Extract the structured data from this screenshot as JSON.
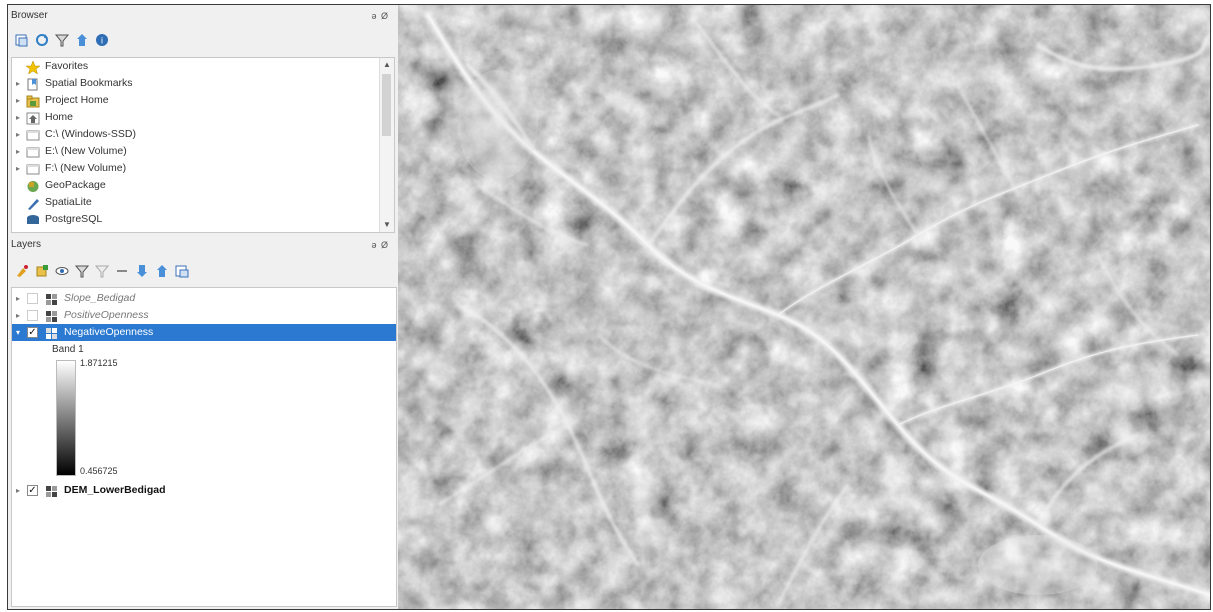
{
  "browser": {
    "title": "Browser",
    "window_controls": "ə Ø",
    "toolbar_icons": [
      "add-selected-icon",
      "refresh-icon",
      "filter-icon",
      "collapse-all-icon",
      "help-icon"
    ],
    "items": [
      {
        "label": "Favorites",
        "icon": "star-icon",
        "expandable": false
      },
      {
        "label": "Spatial Bookmarks",
        "icon": "bookmark-icon",
        "expandable": true
      },
      {
        "label": "Project Home",
        "icon": "folder-icon",
        "expandable": true
      },
      {
        "label": "Home",
        "icon": "home-icon",
        "expandable": true
      },
      {
        "label": "C:\\ (Windows-SSD)",
        "icon": "drive-icon",
        "expandable": true
      },
      {
        "label": "E:\\ (New Volume)",
        "icon": "drive-icon",
        "expandable": true
      },
      {
        "label": "F:\\ (New Volume)",
        "icon": "drive-icon",
        "expandable": true
      },
      {
        "label": "GeoPackage",
        "icon": "geopackage-icon",
        "expandable": false
      },
      {
        "label": "SpatiaLite",
        "icon": "spatialite-icon",
        "expandable": false
      },
      {
        "label": "PostgreSQL",
        "icon": "database-icon",
        "expandable": false
      }
    ]
  },
  "layers": {
    "title": "Layers",
    "window_controls": "ə Ø",
    "toolbar_icons": [
      "style-icon",
      "add-group-icon",
      "manage-visibility-icon",
      "filter-legend-icon",
      "filter-expression-icon",
      "remove-layer-icon",
      "expand-all-icon",
      "collapse-all-icon",
      "layer-properties-icon"
    ],
    "items": [
      {
        "label": "Slope_Bedigad",
        "checked": false,
        "style": "italic",
        "selected": false
      },
      {
        "label": "PositiveOpenness",
        "checked": false,
        "style": "italic",
        "selected": false
      },
      {
        "label": "NegativeOpenness",
        "checked": true,
        "style": "normal",
        "selected": true
      },
      {
        "label": "DEM_LowerBedigad",
        "checked": true,
        "style": "bold",
        "selected": false
      }
    ],
    "legend": {
      "band": "Band 1",
      "max": "1.871215",
      "min": "0.456725"
    }
  },
  "map": {
    "description_icon": "hillshade-raster"
  }
}
